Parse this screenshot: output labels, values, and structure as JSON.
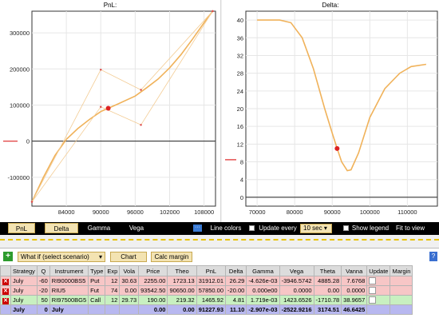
{
  "chart_data": [
    {
      "type": "line",
      "title": "PnL:",
      "xlabel": "",
      "ylabel": "",
      "xlim": [
        78000,
        110000
      ],
      "ylim": [
        -180000,
        360000
      ],
      "x_ticks": [
        "84000",
        "90000",
        "96000",
        "102000",
        "108000"
      ],
      "y_ticks": [
        "300000",
        "200000",
        "100000",
        "0",
        "-100000"
      ],
      "series": [
        {
          "values": [
            [
              78000,
              -168000
            ],
            [
              80000,
              -100000
            ],
            [
              82000,
              -40000
            ],
            [
              84000,
              5000
            ],
            [
              86000,
              35000
            ],
            [
              88000,
              60000
            ],
            [
              90000,
              82000
            ],
            [
              91300,
              91000
            ],
            [
              93000,
              103000
            ],
            [
              96000,
              125000
            ],
            [
              98000,
              148000
            ],
            [
              100000,
              172000
            ],
            [
              102000,
              203000
            ],
            [
              104000,
              240000
            ],
            [
              106000,
              283000
            ],
            [
              108000,
              328000
            ],
            [
              109500,
              360000
            ]
          ]
        },
        {
          "values": [
            [
              78000,
              -168000
            ],
            [
              90000,
              198000
            ],
            [
              97000,
              142000
            ],
            [
              109500,
              360000
            ]
          ]
        },
        {
          "values": [
            [
              78000,
              -168000
            ],
            [
              90000,
              95000
            ],
            [
              97000,
              45000
            ],
            [
              109500,
              360000
            ]
          ]
        }
      ],
      "current_point": [
        91300,
        91000
      ]
    },
    {
      "type": "line",
      "title": "Delta:",
      "xlabel": "",
      "ylabel": "",
      "xlim": [
        67000,
        118000
      ],
      "ylim": [
        -2,
        42
      ],
      "x_ticks": [
        "70000",
        "80000",
        "90000",
        "100000",
        "110000"
      ],
      "y_ticks": [
        "40",
        "36",
        "32",
        "28",
        "24",
        "20",
        "16",
        "12",
        "8",
        "4",
        "0"
      ],
      "series": [
        {
          "values": [
            [
              70000,
              40
            ],
            [
              76000,
              40
            ],
            [
              79000,
              39.4
            ],
            [
              82000,
              36
            ],
            [
              85000,
              29
            ],
            [
              88000,
              20
            ],
            [
              90000,
              14.5
            ],
            [
              91300,
              11
            ],
            [
              92500,
              8
            ],
            [
              94000,
              6
            ],
            [
              95000,
              6.2
            ],
            [
              97000,
              10
            ],
            [
              100000,
              18
            ],
            [
              104000,
              24.5
            ],
            [
              108000,
              28
            ],
            [
              111000,
              29.5
            ],
            [
              115000,
              30
            ]
          ]
        }
      ],
      "current_point": [
        91300,
        11
      ]
    }
  ],
  "toolbar": {
    "pnl_label": "PnL",
    "delta_label": "Delta",
    "gamma_label": "Gamma",
    "vega_label": "Vega",
    "line_colors_label": "Line colors",
    "update_every_label": "Update every",
    "update_interval": "10 sec",
    "show_legend_label": "Show legend",
    "fit_label": "Fit to view"
  },
  "controls": {
    "scenario_value": "What if (select scenario)",
    "chart_button": "Chart",
    "calc_margin_button": "Calc margin",
    "help": "?"
  },
  "table": {
    "headers": [
      "Strategy",
      "Q",
      "Instrument",
      "Type",
      "Exp",
      "Vola",
      "Price",
      "Theo",
      "PnL",
      "Delta",
      "Gamma",
      "Vega",
      "Theta",
      "Vanna",
      "Update",
      "Margin"
    ],
    "rows": [
      {
        "style": "red",
        "cells": [
          "July",
          "-60",
          "RI90000BS5",
          "Put",
          "12",
          "30.63",
          "2255.00",
          "1723.13",
          "31912.01",
          "26.29",
          "-4.626e-03",
          "-3946.5742",
          "4885.28",
          "7.6768",
          "",
          ""
        ]
      },
      {
        "style": "red",
        "cells": [
          "July",
          "-20",
          "RIU5",
          "Fut",
          "74",
          "0.00",
          "93542.50",
          "90650.00",
          "57850.00",
          "-20.00",
          "0.000e00",
          "0.0000",
          "0.00",
          "0.0000",
          "",
          ""
        ]
      },
      {
        "style": "green",
        "cells": [
          "July",
          "50",
          "RI97500BG5",
          "Call",
          "12",
          "29.73",
          "190.00",
          "219.32",
          "1465.92",
          "4.81",
          "1.719e-03",
          "1423.6526",
          "-1710.78",
          "38.9657",
          "",
          ""
        ]
      },
      {
        "style": "blue",
        "cells": [
          "July",
          "0",
          "July",
          "",
          "",
          "",
          "0.00",
          "0.00",
          "91227.93",
          "11.10",
          "-2.907e-03",
          "-2522.9216",
          "3174.51",
          "46.6425",
          "",
          ""
        ]
      }
    ]
  }
}
